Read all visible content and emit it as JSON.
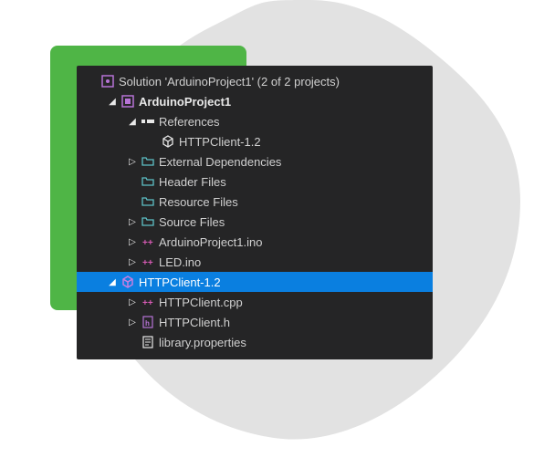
{
  "solution": {
    "label": "Solution 'ArduinoProject1' (2 of 2 projects)"
  },
  "project": {
    "name": "ArduinoProject1",
    "references": {
      "label": "References",
      "items": [
        "HTTPClient-1.2"
      ]
    },
    "folders": {
      "external_deps": "External Dependencies",
      "header_files": "Header Files",
      "resource_files": "Resource Files",
      "source_files": "Source Files"
    },
    "files": {
      "ino_main": "ArduinoProject1.ino",
      "ino_led": "LED.ino"
    }
  },
  "library": {
    "name": "HTTPClient-1.2",
    "files": {
      "cpp": "HTTPClient.cpp",
      "h": "HTTPClient.h",
      "props": "library.properties"
    }
  }
}
